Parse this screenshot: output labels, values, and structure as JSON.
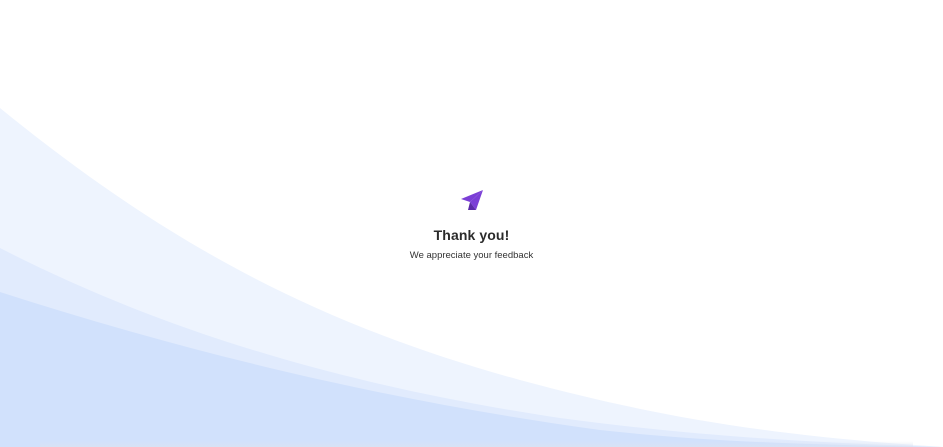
{
  "confirmation": {
    "icon": "paper-plane-icon",
    "title": "Thank you!",
    "message": "We appreciate your feedback"
  },
  "colors": {
    "accent": "#7b3fd6",
    "accent_dark": "#5b2aa8",
    "wave_light": "#eef4fe",
    "wave_mid": "#e1ebfd",
    "wave_dark": "#d1e1fc",
    "title_text": "#2b2b2b"
  }
}
